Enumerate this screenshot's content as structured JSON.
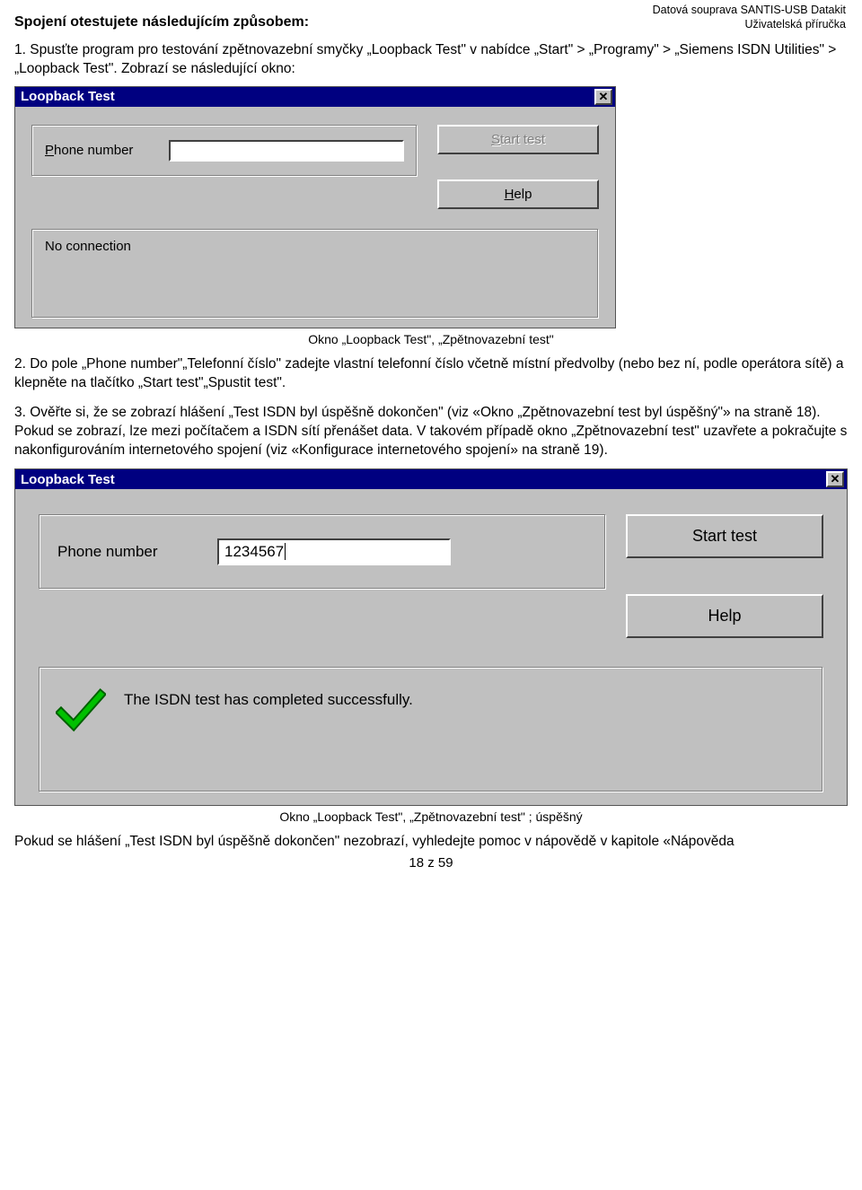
{
  "header": {
    "line1": "Datová souprava SANTIS-USB Datakit",
    "line2": "Uživatelská příručka"
  },
  "intro_heading": "Spojení otestujete následujícím způsobem:",
  "para1": "1. Spusťte program pro testování zpětnovazební smyčky „Loopback Test\" v nabídce „Start\" > „Programy\" > „Siemens ISDN Utilities\" > „Loopback Test\". Zobrazí se následující okno:",
  "screenshot1": {
    "title": "Loopback Test",
    "phone_label": "Phone number",
    "phone_value": "",
    "btn_start": "Start test",
    "btn_help": "Help",
    "status_text": "No connection",
    "caption": "Okno „Loopback Test\", „Zpětnovazební test\""
  },
  "para2": "2. Do pole „Phone number\"„Telefonní číslo\" zadejte vlastní telefonní číslo včetně místní předvolby (nebo bez ní, podle operátora sítě) a klepněte na tlačítko „Start test\"„Spustit test\".",
  "para3": "3. Ověřte si, že se zobrazí hlášení „Test ISDN byl úspěšně dokončen\" (viz «Okno „Zpětnovazební test byl úspěšný\"» na straně 18). Pokud se zobrazí, lze mezi počítačem a ISDN sítí přenášet data. V takovém případě okno „Zpětnovazební test\" uzavřete a pokračujte s nakonfigurováním internetového spojení (viz «Konfigurace internetového spojení» na straně 19).",
  "screenshot2": {
    "title": "Loopback Test",
    "phone_label": "Phone number",
    "phone_value": "1234567",
    "btn_start": "Start test",
    "btn_help": "Help",
    "status_text": "The ISDN test has completed successfully.",
    "caption": "Okno „Loopback Test\", „Zpětnovazební test\" ; úspěšný"
  },
  "para4": "Pokud se hlášení „Test ISDN byl úspěšně dokončen\" nezobrazí, vyhledejte pomoc v nápovědě v kapitole «Nápověda",
  "page_number": "18 z 59"
}
